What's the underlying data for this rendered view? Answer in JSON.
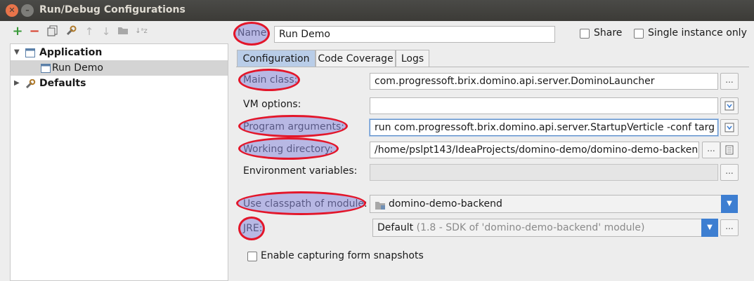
{
  "window": {
    "title": "Run/Debug Configurations"
  },
  "left": {
    "toolbar_icons": [
      "add-icon",
      "remove-icon",
      "copy-icon",
      "wrench-icon",
      "move-up-icon",
      "move-down-icon",
      "folder-icon",
      "sort-icon"
    ],
    "tree": [
      {
        "label": "Application",
        "expanded": true
      },
      {
        "label": "Run Demo",
        "selected": true
      },
      {
        "label": "Defaults",
        "expanded": false
      }
    ]
  },
  "header": {
    "name_label": "Name:",
    "name_value": "Run Demo",
    "share_label": "Share",
    "single_instance_label": "Single instance only"
  },
  "tabs": [
    {
      "label": "Configuration",
      "active": true
    },
    {
      "label": "Code Coverage",
      "active": false
    },
    {
      "label": "Logs",
      "active": false
    }
  ],
  "form": {
    "main_class_label": "Main class:",
    "main_class_value": "com.progressoft.brix.domino.api.server.DominoLauncher",
    "vm_options_label": "VM options:",
    "vm_options_value": "",
    "program_args_label": "Program arguments:",
    "program_args_value": "run com.progressoft.brix.domino.api.server.StartupVerticle -conf targ",
    "working_dir_label": "Working directory:",
    "working_dir_value": "/home/pslpt143/IdeaProjects/domino-demo/domino-demo-backen",
    "env_vars_label": "Environment variables:",
    "env_vars_value": "",
    "classpath_label": "Use classpath of module:",
    "classpath_value": "domino-demo-backend",
    "jre_label": "JRE:",
    "jre_value": "Default",
    "jre_hint": "(1.8 - SDK of 'domino-demo-backend' module)",
    "ellipsis": "...",
    "snapshots_label": "Enable capturing form snapshots"
  },
  "colors": {
    "accent": "#3d7ed1",
    "highlight_border": "#e3162a",
    "tab_active": "#b9cde8"
  }
}
